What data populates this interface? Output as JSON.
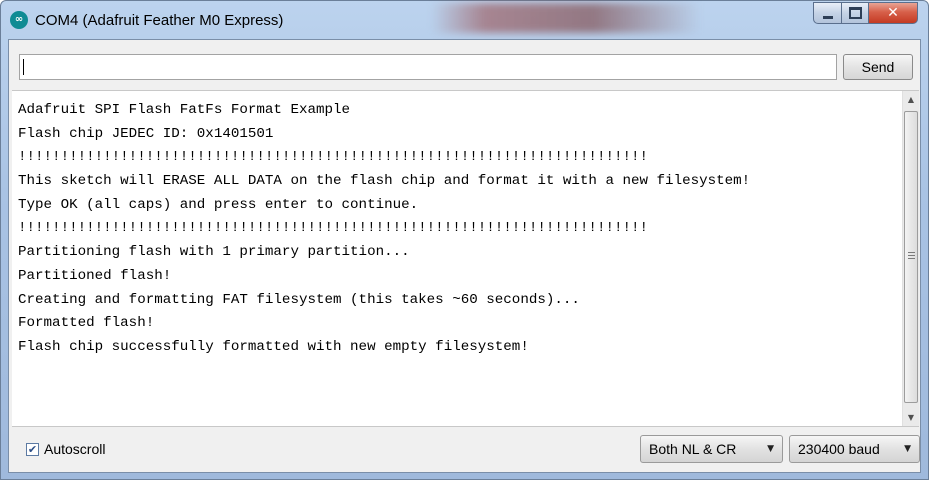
{
  "window": {
    "title": "COM4 (Adafruit Feather M0 Express)",
    "app_icon_glyph": "∞",
    "close_glyph": "✕"
  },
  "input": {
    "value": "",
    "send_label": "Send"
  },
  "output": {
    "lines": [
      "Adafruit SPI Flash FatFs Format Example",
      "Flash chip JEDEC ID: 0x1401501",
      "!!!!!!!!!!!!!!!!!!!!!!!!!!!!!!!!!!!!!!!!!!!!!!!!!!!!!!!!!!!!!!!!!!!!!!!!!!",
      "This sketch will ERASE ALL DATA on the flash chip and format it with a new filesystem!",
      "Type OK (all caps) and press enter to continue.",
      "!!!!!!!!!!!!!!!!!!!!!!!!!!!!!!!!!!!!!!!!!!!!!!!!!!!!!!!!!!!!!!!!!!!!!!!!!!",
      "Partitioning flash with 1 primary partition...",
      "Partitioned flash!",
      "Creating and formatting FAT filesystem (this takes ~60 seconds)...",
      "Formatted flash!",
      "Flash chip successfully formatted with new empty filesystem!"
    ]
  },
  "footer": {
    "autoscroll_label": "Autoscroll",
    "autoscroll_checked": true,
    "line_ending": "Both NL & CR",
    "baud_rate": "230400 baud"
  },
  "colors": {
    "title_bar": "#a9c3e4",
    "close_button": "#c43a23",
    "arduino_teal": "#0f8b94"
  },
  "icons": [
    "arduino-logo-icon",
    "minimize-icon",
    "maximize-icon",
    "close-icon",
    "scroll-up-icon",
    "scroll-down-icon",
    "checkbox-check-icon",
    "dropdown-caret-icon"
  ]
}
